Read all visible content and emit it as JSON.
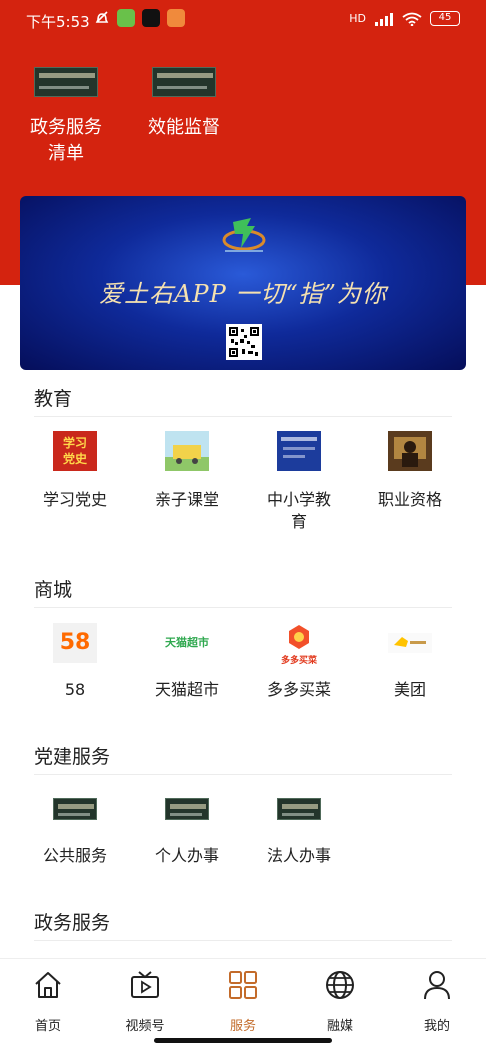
{
  "status_bar": {
    "time": "下午5:53",
    "network": "HD",
    "battery": "45"
  },
  "top_services": [
    {
      "label": "政务服务清单",
      "line1": "政务服务",
      "line2": "清单"
    },
    {
      "label": "效能监督",
      "line1": "效能监督",
      "line2": ""
    }
  ],
  "banner": {
    "slogan": "爱土右APP 一切“指”为你"
  },
  "sections": {
    "education": {
      "title": "教育",
      "items": [
        {
          "label": "学习党史",
          "thumb_text": "学习\n党史"
        },
        {
          "label": "亲子课堂"
        },
        {
          "label": "中小学教育",
          "line1": "中小学教",
          "line2": "育"
        },
        {
          "label": "职业资格"
        }
      ]
    },
    "mall": {
      "title": "商城",
      "items": [
        {
          "label": "58",
          "thumb_text": "58"
        },
        {
          "label": "天猫超市",
          "thumb_text": "天猫超市"
        },
        {
          "label": "多多买菜",
          "thumb_text": "多多买菜"
        },
        {
          "label": "美团"
        }
      ]
    },
    "party": {
      "title": "党建服务",
      "items": [
        {
          "label": "公共服务"
        },
        {
          "label": "个人办事"
        },
        {
          "label": "法人办事"
        }
      ]
    },
    "government": {
      "title": "政务服务"
    }
  },
  "bottom_nav": [
    {
      "label": "首页",
      "icon": "home-icon"
    },
    {
      "label": "视频号",
      "icon": "video-icon"
    },
    {
      "label": "服务",
      "icon": "grid-icon",
      "active": true
    },
    {
      "label": "融媒",
      "icon": "globe-icon"
    },
    {
      "label": "我的",
      "icon": "user-icon"
    }
  ],
  "colors": {
    "header_red": "#d4230f",
    "active_orange": "#c36b2a",
    "banner_blue": "#0f2a9a"
  }
}
